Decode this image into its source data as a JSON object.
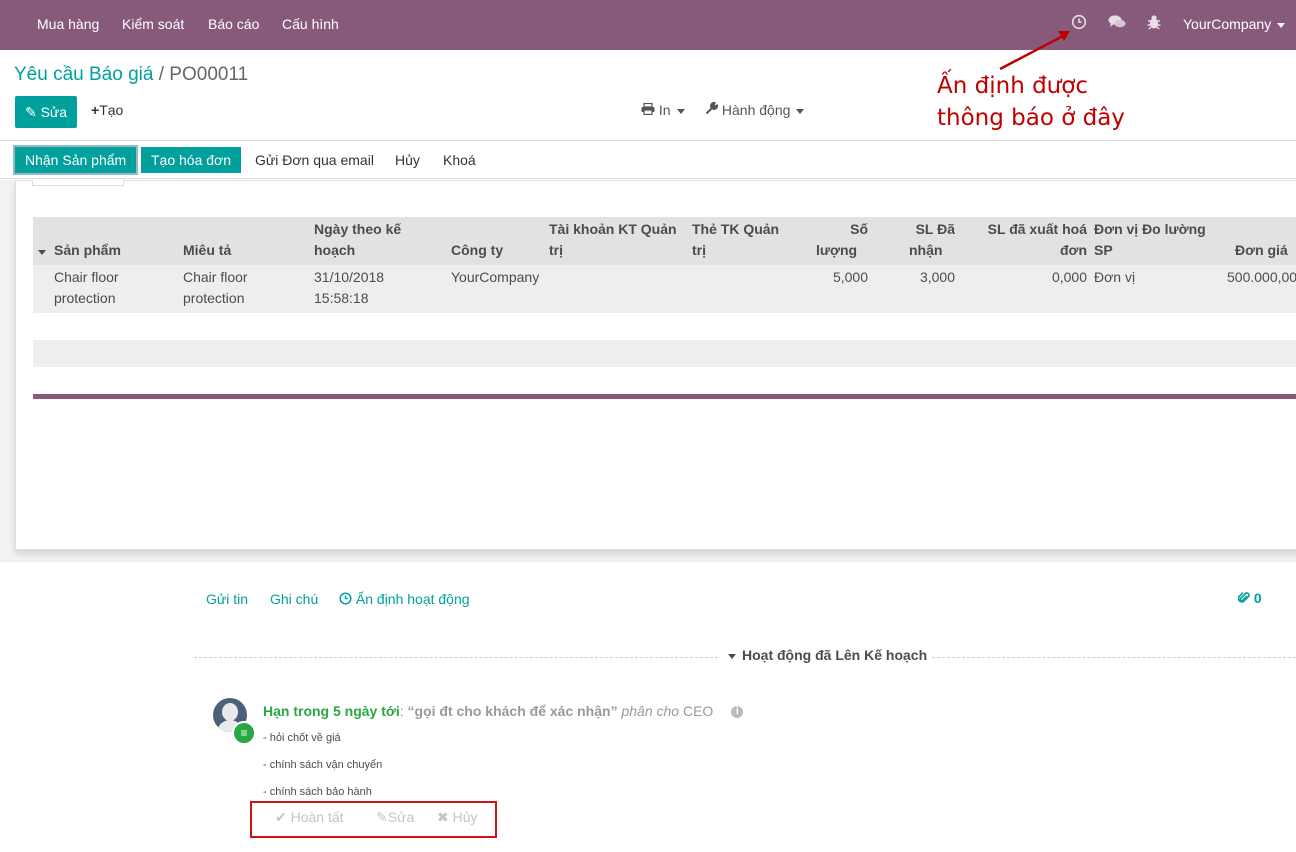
{
  "topbar": {
    "menus": [
      "Mua hàng",
      "Kiểm soát",
      "Báo cáo",
      "Cấu hình"
    ],
    "company": "YourCompany",
    "icons": [
      "clock-icon",
      "chat-icon",
      "bug-icon"
    ]
  },
  "breadcrumb": {
    "parent": "Yêu cầu Báo giá",
    "separator": "/",
    "current": "PO00011"
  },
  "buttons": {
    "edit": "Sửa",
    "create": "Tạo",
    "print": "In",
    "action": "Hành động"
  },
  "status_buttons": {
    "receive": "Nhận Sản phẩm",
    "invoice": "Tạo hóa đơn",
    "email": "Gửi Đơn qua email",
    "cancel": "Hủy",
    "lock": "Khoá"
  },
  "table": {
    "headers": {
      "product": "Sản phẩm",
      "description": "Miêu tả",
      "date_l1": "Ngày theo kế",
      "date_l2": "hoạch",
      "company": "Công ty",
      "account_l1": "Tài khoản KT Quản",
      "account_l2": "trị",
      "tag_l1": "Thẻ TK Quản",
      "tag_l2": "trị",
      "qty_l1": "Số",
      "qty_l2": "lượng",
      "received_l1": "SL Đã",
      "received_l2": "nhận",
      "invoiced_l1": "SL đã xuất hoá",
      "invoiced_l2": "đơn",
      "uom_l1": "Đơn vị Đo lường",
      "uom_l2": "SP",
      "price": "Đơn giá"
    },
    "rows": [
      {
        "product_l1": "Chair floor",
        "product_l2": "protection",
        "description_l1": "Chair floor",
        "description_l2": "protection",
        "date_l1": "31/10/2018",
        "date_l2": "15:58:18",
        "company": "YourCompany",
        "qty": "5,000",
        "received": "3,000",
        "invoiced": "0,000",
        "uom": "Đơn vị",
        "price": "500.000,00"
      }
    ]
  },
  "chatter": {
    "send_message": "Gửi tin",
    "log_note": "Ghi chú",
    "schedule": "Ấn định hoạt động",
    "attachments": "0",
    "section_title": "Hoạt động đã Lên Kế hoạch",
    "activity": {
      "due": "Hạn trong 5 ngày tới",
      "summary": "“gọi đt cho khách để xác nhận”",
      "assigned": "phân cho",
      "assignee": "CEO",
      "notes": [
        "- hỏi chốt về giá",
        "- chính sách vận chuyển",
        "- chính sách bảo hành"
      ],
      "done": "Hoàn tất",
      "edit": "Sửa",
      "cancel": "Hủy"
    }
  },
  "annotation": {
    "text": "Ấn định được thông báo ở đây",
    "color": "#c00000"
  },
  "colors": {
    "brand": "#875a7b",
    "accent": "#00a09d",
    "due": "#28a745",
    "highlight": "#d0121b"
  }
}
